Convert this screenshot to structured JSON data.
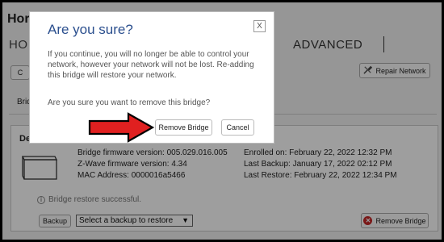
{
  "page": {
    "title": "Hor",
    "nav_home": "HO",
    "nav_advanced": "ADVANCED",
    "left_btn_label": "C",
    "repair_network": "Repair Network",
    "tab_label": "Brid"
  },
  "bridge_card": {
    "heading": "De",
    "firmware": "Bridge firmware version: 005.029.016.005",
    "zwave": "Z-Wave firmware version: 4.34",
    "mac": "MAC Address: 0000016a5466",
    "enrolled": "Enrolled on: February 22, 2022 12:32 PM",
    "last_backup": "Last Backup: January 17, 2022 02:12 PM",
    "last_restore": "Last Restore: February 22, 2022 12:34 PM",
    "restore_message": "Bridge restore successful.",
    "backup_button": "Backup",
    "backup_select": "Select a backup to restore",
    "remove_bridge": "Remove Bridge"
  },
  "modal": {
    "title": "Are you sure?",
    "close": "X",
    "body": "If you continue, you will no longer be able to control your network, however your network will not be lost. Re-adding this bridge will restore your network.",
    "question": "Are you sure you want to remove this bridge?",
    "remove_button": "Remove Bridge",
    "cancel_button": "Cancel"
  },
  "colors": {
    "title_blue": "#2b4f8e",
    "arrow_red": "#e02020",
    "remove_icon_red": "#c62828"
  }
}
